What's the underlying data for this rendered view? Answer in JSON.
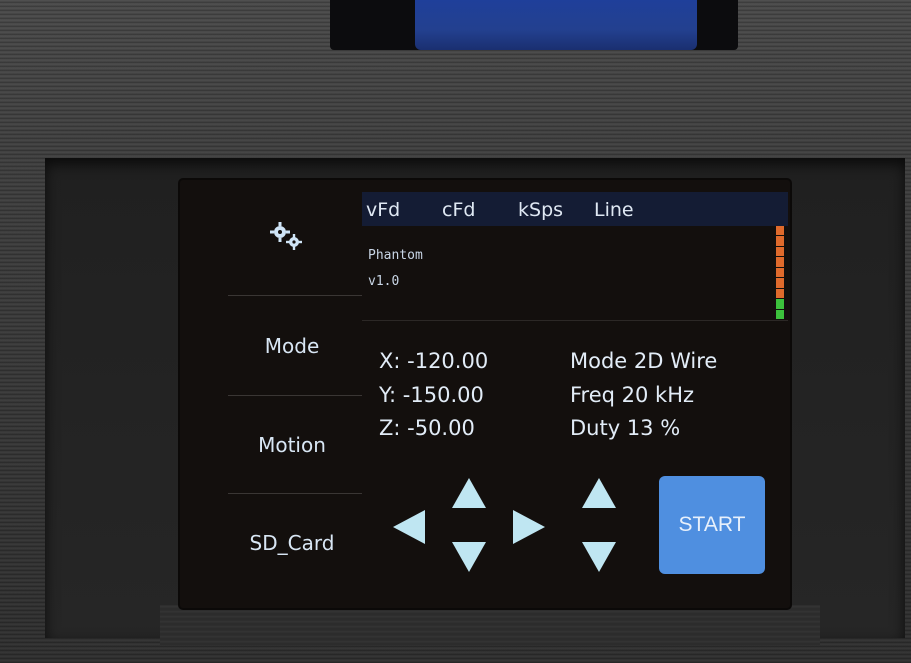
{
  "screen": {
    "sidebar": {
      "settings_icon": "gears-icon",
      "items": [
        {
          "label": "Mode"
        },
        {
          "label": "Motion"
        },
        {
          "label": "SD_Card"
        }
      ]
    },
    "header": {
      "tabs": [
        "vFd",
        "cFd",
        "kSps",
        "Line"
      ]
    },
    "info": {
      "name": "Phantom",
      "version": "v1.0"
    },
    "readouts": {
      "x": "X: -120.00",
      "y": "Y: -150.00",
      "z": "Z: -50.00",
      "mode": "Mode 2D Wire",
      "freq": "Freq 20 kHz",
      "duty": "Duty 13 %"
    },
    "controls": {
      "arrows": [
        "up-arrow-icon",
        "down-arrow-icon",
        "left-arrow-icon",
        "right-arrow-icon",
        "z-up-arrow-icon",
        "z-down-arrow-icon"
      ],
      "start_label": "START"
    },
    "colors": {
      "accent": "#4f8fe0",
      "arrow": "#bfe6f2",
      "meter_red": "#e06a2c",
      "meter_green": "#3cc13c"
    }
  }
}
